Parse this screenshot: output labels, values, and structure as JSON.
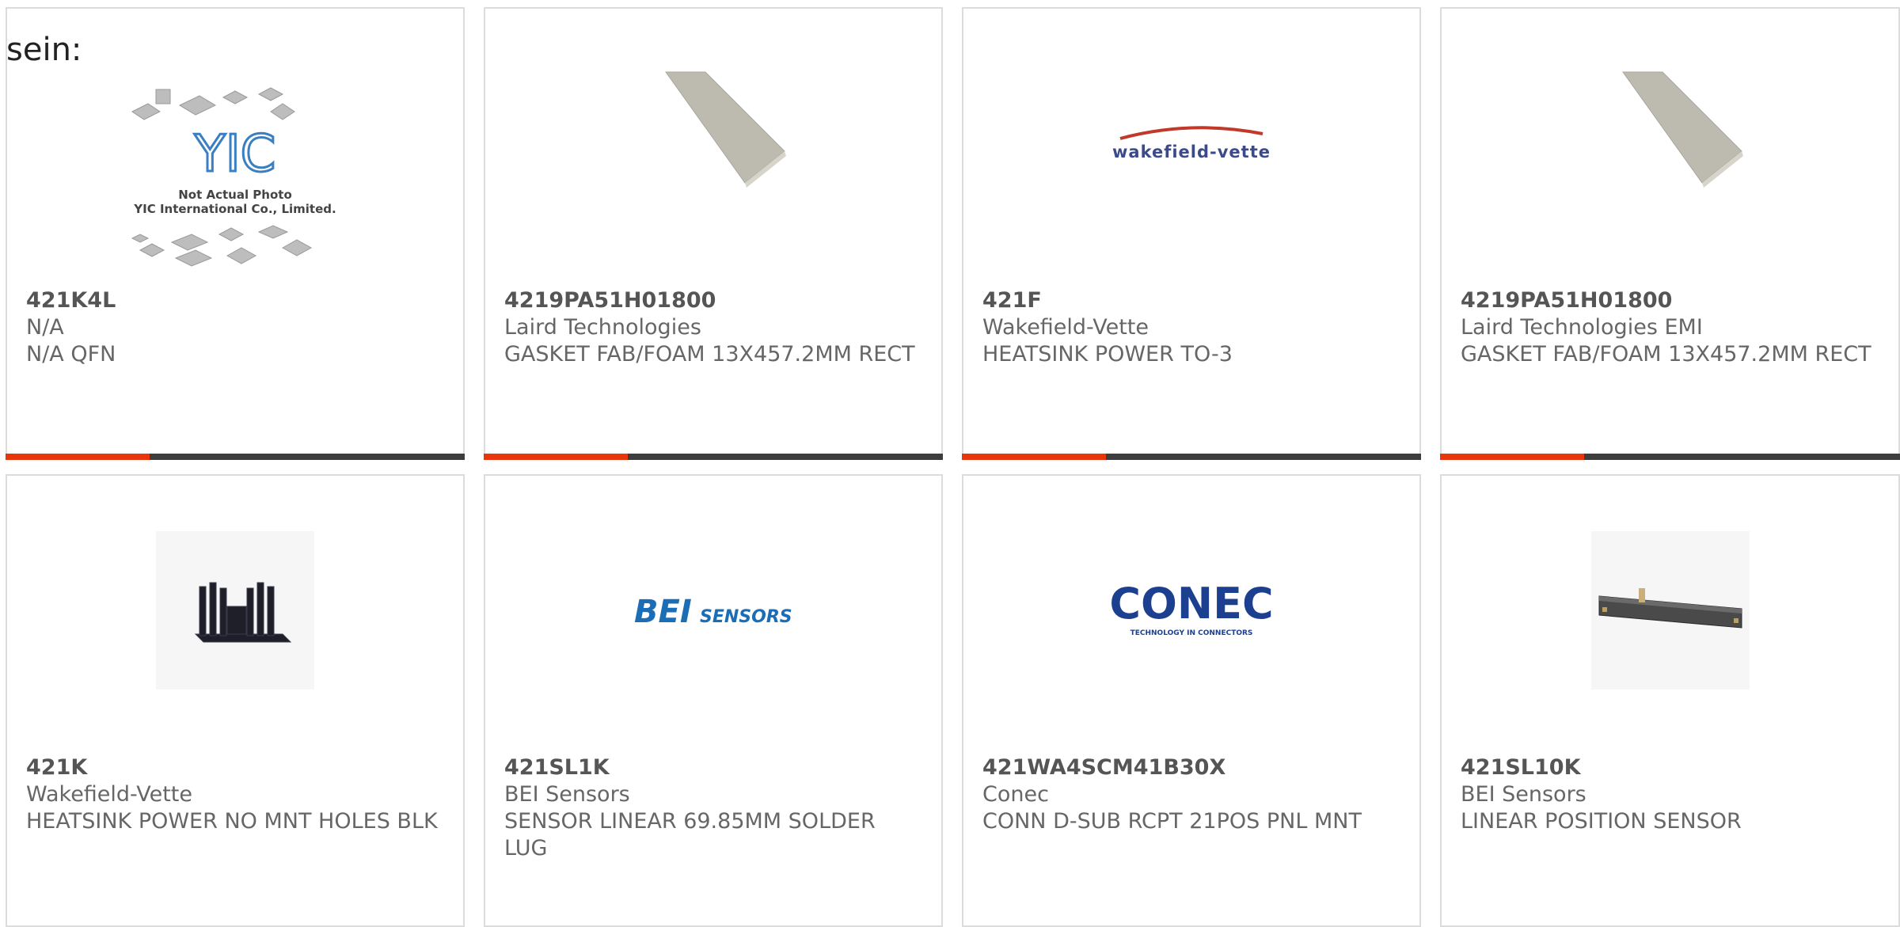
{
  "intro_text": "sein:",
  "placeholder_logo": {
    "brand": "YIC",
    "line1": "Not Actual Photo",
    "line2": "YIC International Co., Limited."
  },
  "brand_logos": {
    "wakefield": "wakefield-vette",
    "bei_main": "BEI",
    "bei_sub": "SENSORS",
    "conec_main": "CONEC",
    "conec_sub": "TECHNOLOGY IN CONNECTORS"
  },
  "products": [
    {
      "part": "421K4L",
      "maker": "N/A",
      "desc": "N/A QFN",
      "image": "not-actual-photo"
    },
    {
      "part": "4219PA51H01800",
      "maker": "Laird Technologies",
      "desc": "GASKET FAB/FOAM 13X457.2MM RECT",
      "image": "foam-gasket"
    },
    {
      "part": "421F",
      "maker": "Wakefield-Vette",
      "desc": "HEATSINK POWER TO-3",
      "image": "wakefield-logo"
    },
    {
      "part": "4219PA51H01800",
      "maker": "Laird Technologies EMI",
      "desc": "GASKET FAB/FOAM 13X457.2MM RECT",
      "image": "foam-gasket"
    },
    {
      "part": "421K",
      "maker": "Wakefield-Vette",
      "desc": "HEATSINK POWER NO MNT HOLES BLK",
      "image": "heatsink"
    },
    {
      "part": "421SL1K",
      "maker": "BEI Sensors",
      "desc": "SENSOR LINEAR 69.85MM SOLDER LUG",
      "image": "bei-logo"
    },
    {
      "part": "421WA4SCM41B30X",
      "maker": "Conec",
      "desc": "CONN D-SUB RCPT 21POS PNL MNT",
      "image": "conec-logo"
    },
    {
      "part": "421SL10K",
      "maker": "BEI Sensors",
      "desc": "LINEAR POSITION SENSOR",
      "image": "linear-sensor"
    }
  ],
  "colors": {
    "accent": "#e8360c",
    "bar": "#3d3d3d",
    "border": "#dcdcdc",
    "text": "#666666"
  }
}
